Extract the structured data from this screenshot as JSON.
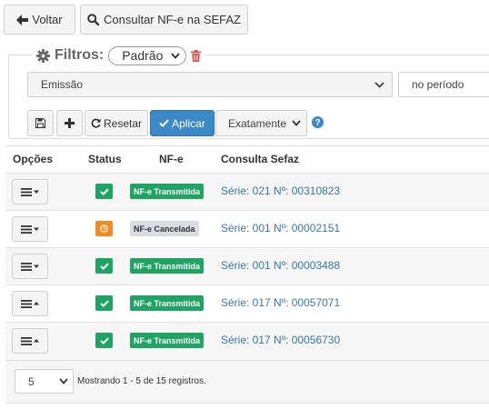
{
  "toolbar": {
    "back_label": "Voltar",
    "consult_label": "Consultar NF-e na SEFAZ"
  },
  "filters": {
    "title": "Filtros:",
    "preset": "Padrão",
    "field": "Emissão",
    "period": "no período",
    "reset_label": "Resetar",
    "apply_label": "Aplicar",
    "match_mode": "Exatamente"
  },
  "table": {
    "headers": {
      "options": "Opções",
      "status": "Status",
      "nfe": "NF-e",
      "sefaz": "Consulta Sefaz"
    },
    "rows": [
      {
        "status": "ok",
        "badge": "NF-e Transmitida",
        "link": "Série: 021 Nº: 00310823",
        "menu": "down"
      },
      {
        "status": "cancel",
        "badge": "NF-e Cancelada",
        "link": "Série: 001 Nº: 00002151",
        "menu": "down"
      },
      {
        "status": "ok",
        "badge": "NF-e Transmitida",
        "link": "Série: 001 Nº: 00003488",
        "menu": "down"
      },
      {
        "status": "ok",
        "badge": "NF-e Transmitida",
        "link": "Série: 017 Nº: 00057071",
        "menu": "up"
      },
      {
        "status": "ok",
        "badge": "NF-e Transmitida",
        "link": "Série: 017 Nº: 00056730",
        "menu": "up"
      }
    ]
  },
  "pagination": {
    "page_size": "5",
    "showing": "Mostrando 1 - 5 de 15 registros."
  },
  "colors": {
    "success": "#1fa463",
    "warning": "#f58a20",
    "primary": "#3b8ac7",
    "cancel_badge": "#d9dde3"
  }
}
